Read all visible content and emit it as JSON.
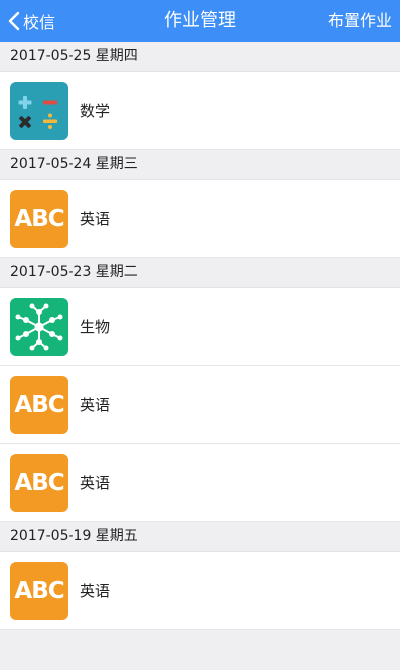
{
  "nav": {
    "back_label": "校信",
    "title": "作业管理",
    "action_label": "布置作业"
  },
  "colors": {
    "nav_bg": "#3d8ff7",
    "english_icon": "#f39a25",
    "math_icon": "#2a9fb4",
    "biology_icon": "#15b57a"
  },
  "groups": [
    {
      "date": "2017-05-25 星期四",
      "items": [
        {
          "subject": "数学",
          "icon": "math-icon"
        }
      ]
    },
    {
      "date": "2017-05-24 星期三",
      "items": [
        {
          "subject": "英语",
          "icon": "abc-icon",
          "icon_text": "ABC"
        }
      ]
    },
    {
      "date": "2017-05-23 星期二",
      "items": [
        {
          "subject": "生物",
          "icon": "molecule-icon"
        },
        {
          "subject": "英语",
          "icon": "abc-icon",
          "icon_text": "ABC"
        },
        {
          "subject": "英语",
          "icon": "abc-icon",
          "icon_text": "ABC"
        }
      ]
    },
    {
      "date": "2017-05-19 星期五",
      "items": [
        {
          "subject": "英语",
          "icon": "abc-icon",
          "icon_text": "ABC"
        }
      ]
    }
  ]
}
